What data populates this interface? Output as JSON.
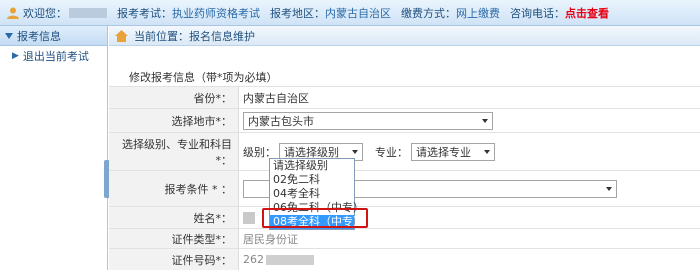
{
  "topbar": {
    "welcome": "欢迎您：",
    "exam_label": "报考考试：",
    "exam_value": "执业药师资格考试",
    "region_label": "报考地区：",
    "region_value": "内蒙古自治区",
    "payment_label": "缴费方式：",
    "payment_value": "网上缴费",
    "hotline_label": "咨询电话：",
    "hotline_link": "点击查看"
  },
  "sidebar": {
    "header": "报考信息",
    "items": [
      {
        "label": "退出当前考试"
      }
    ]
  },
  "breadcrumb": {
    "text": "当前位置：报名信息维护"
  },
  "form": {
    "title": "修改报考信息（带*项为必填）",
    "province_label": "省份*：",
    "province_value": "内蒙古自治区",
    "city_label": "选择地市*：",
    "city_value": "内蒙古包头市",
    "level_subject_label": "选择级别、专业和科目*：",
    "level_label": "级别：",
    "level_value": "请选择级别",
    "major_label": "专业：",
    "major_value": "请选择专业",
    "condition_label": "报考条件 * ：",
    "name_label": "姓名*：",
    "id_type_label": "证件类型*：",
    "id_type_value": "居民身份证",
    "id_number_label": "证件号码*：",
    "id_number_value": "262"
  },
  "level_dropdown": {
    "options": [
      "请选择级别",
      "02免二科",
      "04考全科",
      "06免二科（中专）",
      "08考全科（中专）"
    ],
    "selected_index": 4
  }
}
